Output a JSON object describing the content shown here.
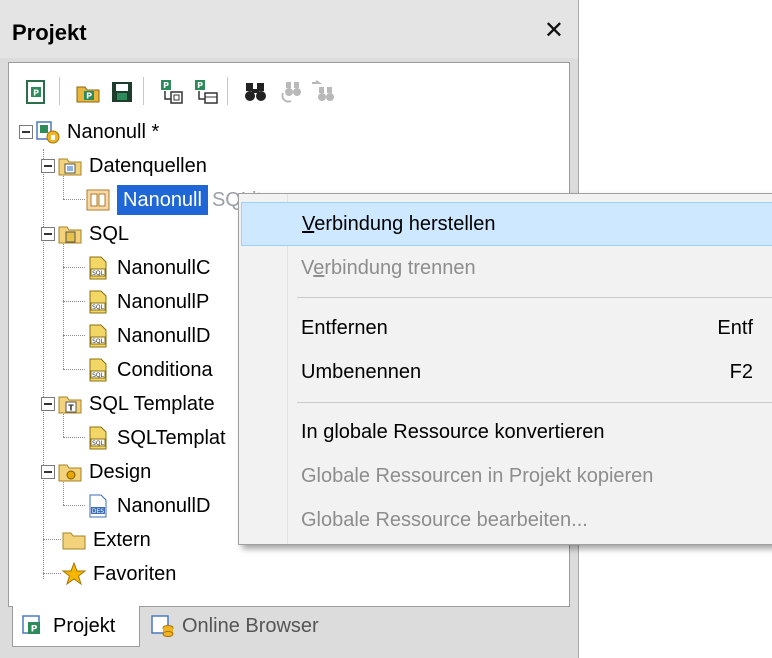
{
  "panel": {
    "title": "Projekt",
    "close_glyph": "✕"
  },
  "toolbar": {
    "icons": [
      "new-project-icon",
      "open-project-icon",
      "save-project-icon",
      "add-files-icon",
      "add-folder-icon",
      "find-icon",
      "find-next-icon",
      "find-prev-icon"
    ]
  },
  "tree": {
    "root": {
      "label": "Nanonull *",
      "icon": "project-icon"
    },
    "datenquellen": {
      "label": "Datenquellen",
      "icon": "datasource-folder-icon"
    },
    "datasource_item": {
      "label": "Nanonull",
      "label_suffix": "SQLite",
      "icon": "database-connection-icon"
    },
    "sql": {
      "label": "SQL",
      "icon": "sql-folder-icon"
    },
    "sql_items": [
      {
        "label": "NanonullC",
        "icon": "sql-file-icon"
      },
      {
        "label": "NanonullP",
        "icon": "sql-file-icon"
      },
      {
        "label": "NanonullD",
        "icon": "sql-file-icon"
      },
      {
        "label": "Conditiona",
        "icon": "sql-file-icon"
      }
    ],
    "sql_templates": {
      "label": "SQL Template",
      "icon": "template-folder-icon"
    },
    "sql_template_items": [
      {
        "label": "SQLTemplat",
        "icon": "sql-template-file-icon"
      }
    ],
    "design": {
      "label": "Design",
      "icon": "design-folder-icon"
    },
    "design_items": [
      {
        "label": "NanonullD",
        "icon": "design-file-icon"
      }
    ],
    "extern": {
      "label": "Extern",
      "icon": "folder-icon"
    },
    "favoriten": {
      "label": "Favoriten",
      "icon": "star-icon"
    }
  },
  "tabs": [
    {
      "label": "Projekt",
      "active": true,
      "icon": "project-tab-icon"
    },
    {
      "label": "Online Browser",
      "active": false,
      "icon": "online-browser-icon"
    }
  ],
  "context_menu": {
    "items": [
      {
        "label": "Verbindung herstellen",
        "mnemonic": "V",
        "shortcut": "",
        "enabled": true,
        "highlighted": true
      },
      {
        "label": "Verbindung trennen",
        "mnemonic": "e",
        "shortcut": "",
        "enabled": false,
        "highlighted": false
      },
      {
        "label": "Entfernen",
        "shortcut": "Entf",
        "enabled": true,
        "highlighted": false
      },
      {
        "label": "Umbenennen",
        "shortcut": "F2",
        "enabled": true,
        "highlighted": false
      },
      {
        "label": "In globale Ressource konvertieren",
        "shortcut": "",
        "enabled": true,
        "highlighted": false
      },
      {
        "label": "Globale Ressourcen in Projekt kopieren",
        "shortcut": "",
        "enabled": false,
        "highlighted": false
      },
      {
        "label": "Globale Ressource bearbeiten...",
        "shortcut": "",
        "enabled": false,
        "highlighted": false
      }
    ]
  },
  "colors": {
    "selection": "#1f66d6",
    "menu_highlight": "#cde8ff",
    "disabled_text": "#8d8d8d"
  }
}
